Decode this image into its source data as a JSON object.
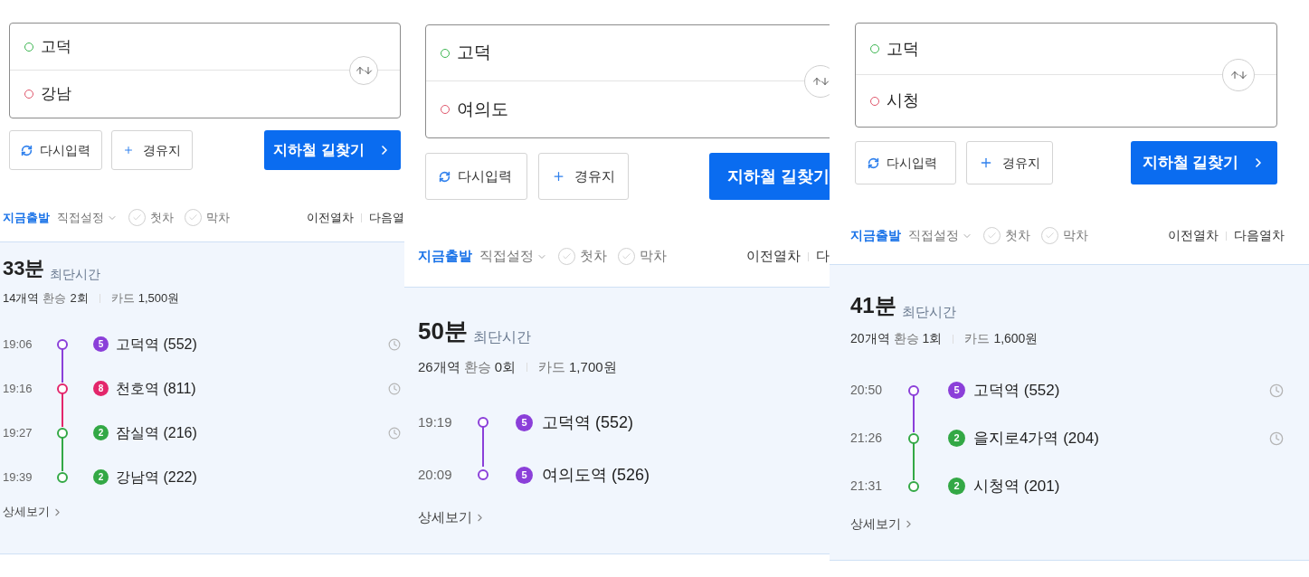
{
  "panels": [
    {
      "kind": "small",
      "origin": "고덕",
      "destination": "강남",
      "reset_label": "다시입력",
      "waypoint_label": "경유지",
      "search_label": "지하철 길찾기",
      "search_chevron": true,
      "modes": [
        {
          "label": "지금출발",
          "selected": true,
          "has_menu": false
        },
        {
          "label": "직접설정",
          "selected": false,
          "has_menu": true
        }
      ],
      "toggles": [
        {
          "label": "첫차",
          "checked": false
        },
        {
          "label": "막차",
          "checked": false
        }
      ],
      "prev_label": "이전열차",
      "next_label": "다음열",
      "result": {
        "duration": "33분",
        "tag": "최단시간",
        "stations": "14개역",
        "transfer_label": "환승",
        "transfers": "2회",
        "fare_label": "카드",
        "fare": "1,500원",
        "detail_label": "상세보기",
        "stops": [
          {
            "time": "19:06",
            "line": "5",
            "color": "#8b3fd9",
            "station": "고덕역 (552)",
            "clock": true
          },
          {
            "time": "19:16",
            "line": "8",
            "color": "#e3266b",
            "station": "천호역 (811)",
            "clock": true
          },
          {
            "time": "19:27",
            "line": "2",
            "color": "#33a845",
            "station": "잠실역 (216)",
            "clock": true
          },
          {
            "time": "19:39",
            "line": "2",
            "color": "#33a845",
            "station": "강남역 (222)",
            "clock": false
          }
        ]
      }
    },
    {
      "kind": "large",
      "origin": "고덕",
      "destination": "여의도",
      "reset_label": "다시입력",
      "waypoint_label": "경유지",
      "search_label": "지하철 길찾기",
      "search_chevron": false,
      "modes": [
        {
          "label": "지금출발",
          "selected": true,
          "has_menu": false
        },
        {
          "label": "직접설정",
          "selected": false,
          "has_menu": true
        }
      ],
      "toggles": [
        {
          "label": "첫차",
          "checked": false
        },
        {
          "label": "막차",
          "checked": false
        }
      ],
      "prev_label": "이전열차",
      "next_label": "다",
      "result": {
        "duration": "50분",
        "tag": "최단시간",
        "stations": "26개역",
        "transfer_label": "환승",
        "transfers": "0회",
        "fare_label": "카드",
        "fare": "1,700원",
        "detail_label": "상세보기",
        "stops": [
          {
            "time": "19:19",
            "line": "5",
            "color": "#8b3fd9",
            "station": "고덕역 (552)",
            "clock": false
          },
          {
            "time": "20:09",
            "line": "5",
            "color": "#8b3fd9",
            "station": "여의도역 (526)",
            "clock": false
          }
        ]
      }
    },
    {
      "kind": "medium",
      "origin": "고덕",
      "destination": "시청",
      "reset_label": "다시입력",
      "waypoint_label": "경유지",
      "search_label": "지하철 길찾기",
      "search_chevron": true,
      "modes": [
        {
          "label": "지금출발",
          "selected": true,
          "has_menu": false
        },
        {
          "label": "직접설정",
          "selected": false,
          "has_menu": true
        }
      ],
      "toggles": [
        {
          "label": "첫차",
          "checked": false
        },
        {
          "label": "막차",
          "checked": false
        }
      ],
      "prev_label": "이전열차",
      "next_label": "다음열차",
      "result": {
        "duration": "41분",
        "tag": "최단시간",
        "stations": "20개역",
        "transfer_label": "환승",
        "transfers": "1회",
        "fare_label": "카드",
        "fare": "1,600원",
        "detail_label": "상세보기",
        "stops": [
          {
            "time": "20:50",
            "line": "5",
            "color": "#8b3fd9",
            "station": "고덕역 (552)",
            "clock": true
          },
          {
            "time": "21:26",
            "line": "2",
            "color": "#33a845",
            "station": "을지로4가역 (204)",
            "clock": true
          },
          {
            "time": "21:31",
            "line": "2",
            "color": "#33a845",
            "station": "시청역 (201)",
            "clock": false
          }
        ]
      }
    }
  ]
}
